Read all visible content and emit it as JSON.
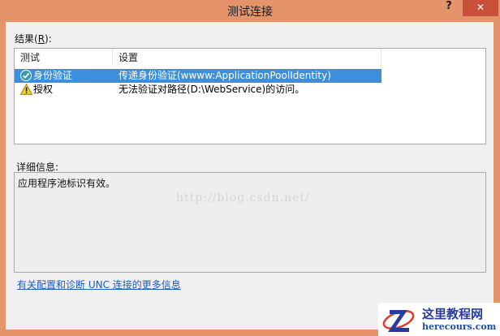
{
  "window": {
    "title": "测试连接",
    "help": "?",
    "close": "✕"
  },
  "results": {
    "label_text": "结果(",
    "label_accel": "R",
    "label_end": "):",
    "columns": [
      "测试",
      "设置"
    ],
    "rows": [
      {
        "icon": "check-circle-icon",
        "test": "身份验证",
        "setting": "传递身份验证(wwww:ApplicationPoolIdentity)",
        "selected": true
      },
      {
        "icon": "warning-icon",
        "test": "授权",
        "setting": "无法验证对路径(D:\\WebService)的访问。",
        "selected": false
      }
    ]
  },
  "details": {
    "label": "详细信息:",
    "text": "应用程序池标识有效。"
  },
  "watermark": "http://blog.csdn.net/",
  "more_link": "有关配置和诊断 UNC 连接的更多信息",
  "site_logo": {
    "title": "这里教程网",
    "subtitle": "herecours.com"
  },
  "colors": {
    "title_bar": "#e5936b",
    "selection": "#3c8fdc",
    "close": "#c7503b",
    "link": "#1a5cc8"
  }
}
